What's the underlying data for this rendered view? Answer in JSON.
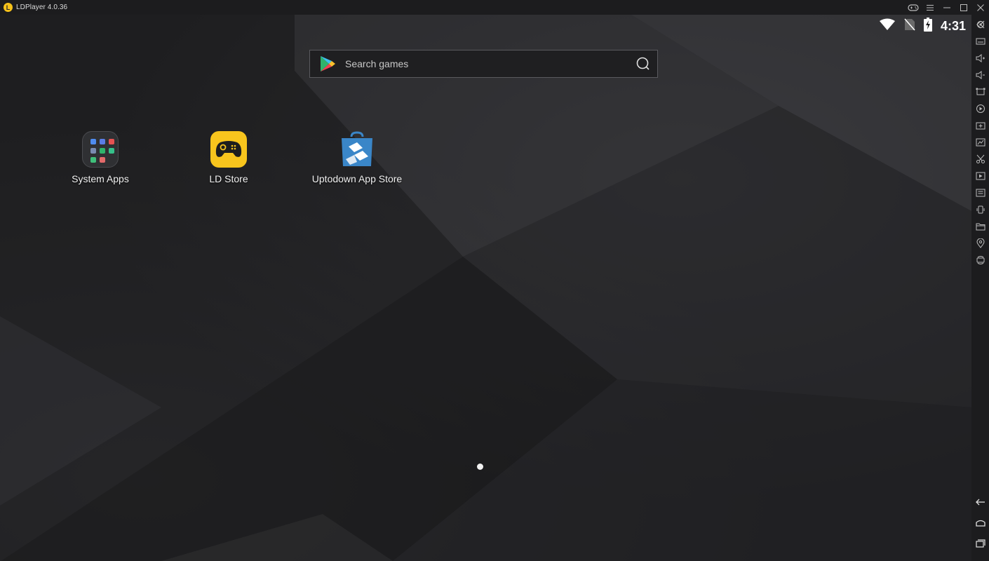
{
  "window": {
    "title": "LDPlayer 4.0.36",
    "controls": [
      "gamepad-icon",
      "menu-icon",
      "minimize-icon",
      "maximize-icon",
      "close-icon"
    ]
  },
  "statusbar": {
    "time": "4:31",
    "icons": [
      "wifi-icon",
      "no-sim-icon",
      "battery-charging-icon"
    ]
  },
  "search": {
    "placeholder": "Search games",
    "value": ""
  },
  "apps": [
    {
      "label": "System Apps",
      "icon": "system-apps-folder-icon"
    },
    {
      "label": "LD Store",
      "icon": "ld-store-icon"
    },
    {
      "label": "Uptodown App Store",
      "icon": "uptodown-icon"
    }
  ],
  "pager": {
    "current": 1,
    "total": 1
  },
  "sidebar_tools": [
    "settings-icon",
    "keyboard-icon",
    "volume-up-icon",
    "volume-down-icon",
    "fullscreen-icon",
    "screen-record-icon",
    "add-apk-icon",
    "screenshot-icon",
    "scissors-icon",
    "video-icon",
    "operation-record-icon",
    "shake-icon",
    "folder-icon",
    "location-icon",
    "rotate-icon"
  ],
  "nav_tools": [
    "back-icon",
    "home-icon",
    "recent-apps-icon"
  ],
  "colors": {
    "accent_yellow": "#f8c51d",
    "titlebar_bg": "#1c1c1e",
    "screen_bg": "#1a1a1c",
    "uptodown_blue": "#3a86c8"
  }
}
